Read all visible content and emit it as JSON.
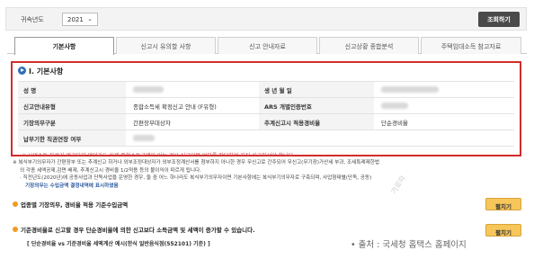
{
  "filter": {
    "year_label": "귀속년도",
    "year_value": "2021",
    "lookup_button": "조회하기"
  },
  "tabs": [
    {
      "label": "기본사항",
      "active": true
    },
    {
      "label": "신고시 유의할 사항",
      "active": false
    },
    {
      "label": "신고 안내자료",
      "active": false
    },
    {
      "label": "신고상황 종합분석",
      "active": false
    },
    {
      "label": "주택임대소득 참고자료",
      "active": false
    }
  ],
  "section": {
    "title": "Ⅰ. 기본사항",
    "rows": [
      {
        "label1": "성 명",
        "value1": "",
        "label2": "생 년 월 일",
        "value2": ""
      },
      {
        "label1": "신고안내유형",
        "value1": "종합소득세 확정신고 안내 (F유형)",
        "label2": "ARS 개별인증번호",
        "value2": ""
      },
      {
        "label1": "기장의무구분",
        "value1": "간편장부대상자",
        "label2": "추계신고시 적용경비율",
        "value2": "단순경비율"
      },
      {
        "label1": "납부기한 직권연장 여부",
        "value1": "",
        "label2": "",
        "value2": ""
      }
    ],
    "cut_text": "※ 사업소득 자료가 제공되지 않더라도 실제 종합소득금액이 있는 경우 신고의무 여부를 판단하여 자진 신고하셔야 합니다."
  },
  "notes": [
    "※ 복식부기의무자가 간편장부 또는 추계신고 하거나 외부조정대상자가 외부조정계산서를 첨부하지 아니한 경우 무신고로 간주되어 무신고(무기장)가산세 부과, 조세특례제한법",
    "의 각종 세액공제,감면 배제, 추계신고시 경비율 1/2적용 등의 불이익이 따르게 됩니다.",
    "· 직전년도(2020년)에 공동사업과 단독사업을 운영한 경우, 둘 중 어느 하나라도 복식부기의무자이면 기본사항에는 복식부기의무자로 구축되며, 사업형태별(단독, 공동)",
    "기장의무는 수입금액 결정내역에 표시하였음"
  ],
  "items": [
    {
      "label": "업종별 기장의무, 경비율 적용 기준수입금액",
      "button": "펼치기"
    },
    {
      "label": "기준경비율로 신고할 경우 단순경비율에 의한 신고보다 소득금액 및 세액이 증가할 수 있습니다.",
      "button": "펼치기"
    }
  ],
  "sub_note": "[ 단순경비율 vs 기준경비율 세액계산 예시(한식 일반음식점(552101) 기준) ]",
  "source": "• 출처 : 국세청 홈택스 홈페이지",
  "watermark": "가로따"
}
